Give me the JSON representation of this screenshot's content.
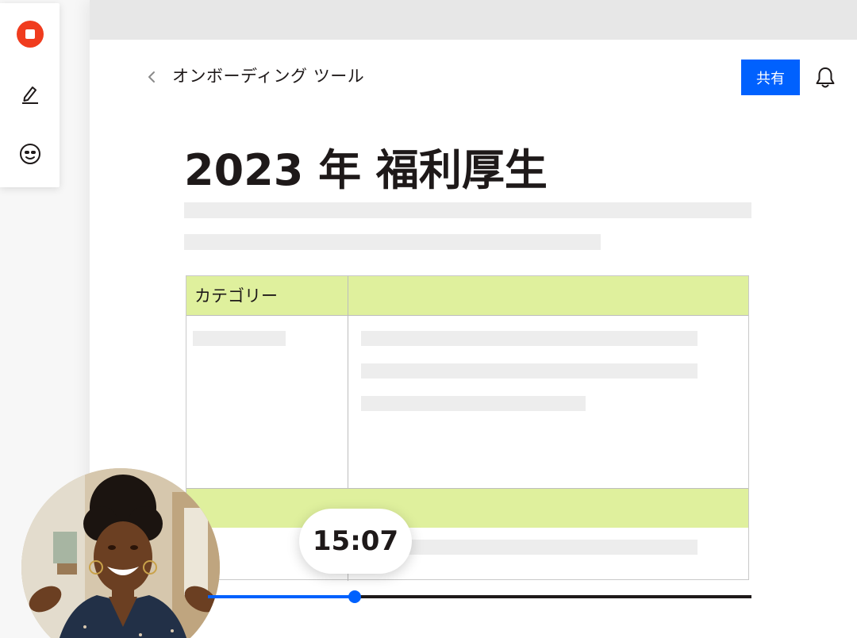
{
  "toolbar": {
    "tools": [
      {
        "icon": "stop-record-icon",
        "color": "#f03c1e"
      },
      {
        "icon": "pen-icon"
      },
      {
        "icon": "emoji-icon"
      }
    ]
  },
  "header": {
    "breadcrumb": "オンボーディング ツール",
    "share_label": "共有",
    "accent_color": "#0061fe"
  },
  "document": {
    "title": "2023 年 福利厚生",
    "table": {
      "header_cell_1": "カテゴリー",
      "header_cell_2": "",
      "highlight_color": "#dff09d"
    }
  },
  "recording": {
    "elapsed": "15:07",
    "progress_fraction": 0.27
  }
}
